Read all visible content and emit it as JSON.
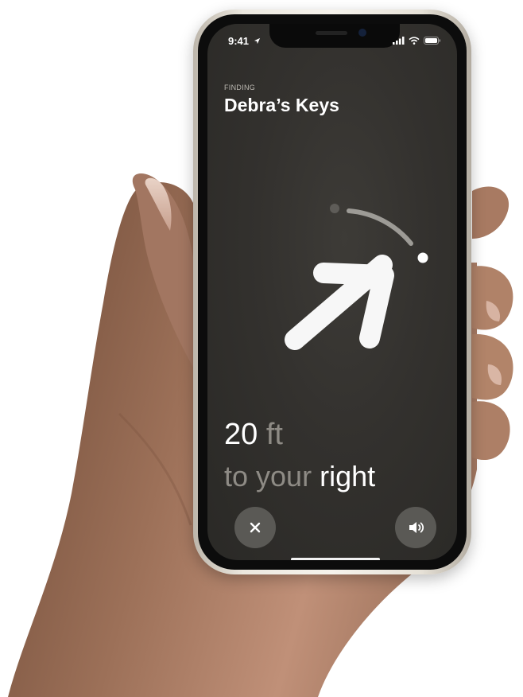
{
  "status_bar": {
    "time": "9:41",
    "icons": [
      "location-arrow-icon",
      "signal-icon",
      "wifi-icon",
      "battery-icon"
    ]
  },
  "header": {
    "section_label": "FINDING",
    "item_name": "Debra’s Keys"
  },
  "guidance": {
    "arrow_icon": "direction-arrow-icon",
    "distance_value": "20",
    "distance_unit": "ft",
    "direction_prefix": "to your",
    "direction_word": "right"
  },
  "controls": {
    "close_icon": "close-icon",
    "sound_icon": "speaker-icon"
  },
  "colors": {
    "screen_background": "#33312e",
    "primary_text": "#ffffff",
    "secondary_text": "#8e8b85",
    "button_fill": "#5a5955"
  }
}
